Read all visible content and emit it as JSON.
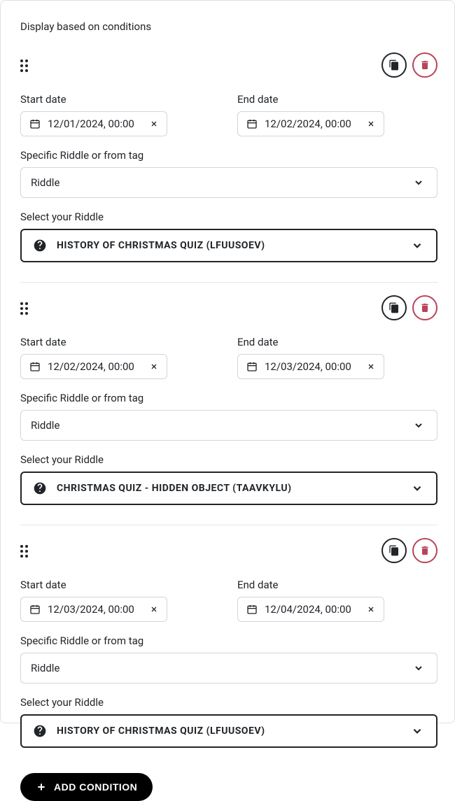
{
  "title": "Display based on conditions",
  "labels": {
    "start_date": "Start date",
    "end_date": "End date",
    "source_label": "Specific Riddle or from tag",
    "select_riddle": "Select your Riddle",
    "add_condition": "ADD CONDITION"
  },
  "conditions": [
    {
      "start_date": "12/01/2024, 00:00",
      "end_date": "12/02/2024, 00:00",
      "source": "Riddle",
      "riddle_label": "HISTORY OF CHRISTMAS QUIZ (LFUUSOEV)"
    },
    {
      "start_date": "12/02/2024, 00:00",
      "end_date": "12/03/2024, 00:00",
      "source": "Riddle",
      "riddle_label": "CHRISTMAS QUIZ - HIDDEN OBJECT (TAAVKYLU)"
    },
    {
      "start_date": "12/03/2024, 00:00",
      "end_date": "12/04/2024, 00:00",
      "source": "Riddle",
      "riddle_label": "HISTORY OF CHRISTMAS QUIZ (LFUUSOEV)"
    }
  ]
}
